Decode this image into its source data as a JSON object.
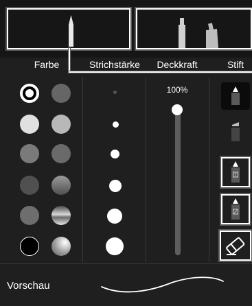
{
  "tabs": [
    {
      "label": "Farbe"
    },
    {
      "label": "Strichstärke"
    },
    {
      "label": "Deckkraft"
    },
    {
      "label": "Stift"
    }
  ],
  "opacity": {
    "label": "100%",
    "value": 1.0
  },
  "footer": {
    "label": "Vorschau"
  },
  "colors": {
    "accent": "#ffffff",
    "background": "#1f1f1f",
    "swatches": [
      [
        "#ffffff",
        "#666666"
      ],
      [
        "#e0e0e0",
        "#b8b8b8"
      ],
      [
        "#7a7a7a",
        "#6a6a6a"
      ],
      [
        "#505050",
        "gradient-gray"
      ],
      [
        "#6e6e6e",
        "gradient-metal"
      ],
      [
        "#000000",
        "gradient-silver"
      ]
    ]
  },
  "icons": {
    "pen_tools": [
      "marker-pen-icon",
      "highlighter-icon",
      "text-marker-icon",
      "pattern-marker-icon",
      "eraser-icon"
    ]
  }
}
